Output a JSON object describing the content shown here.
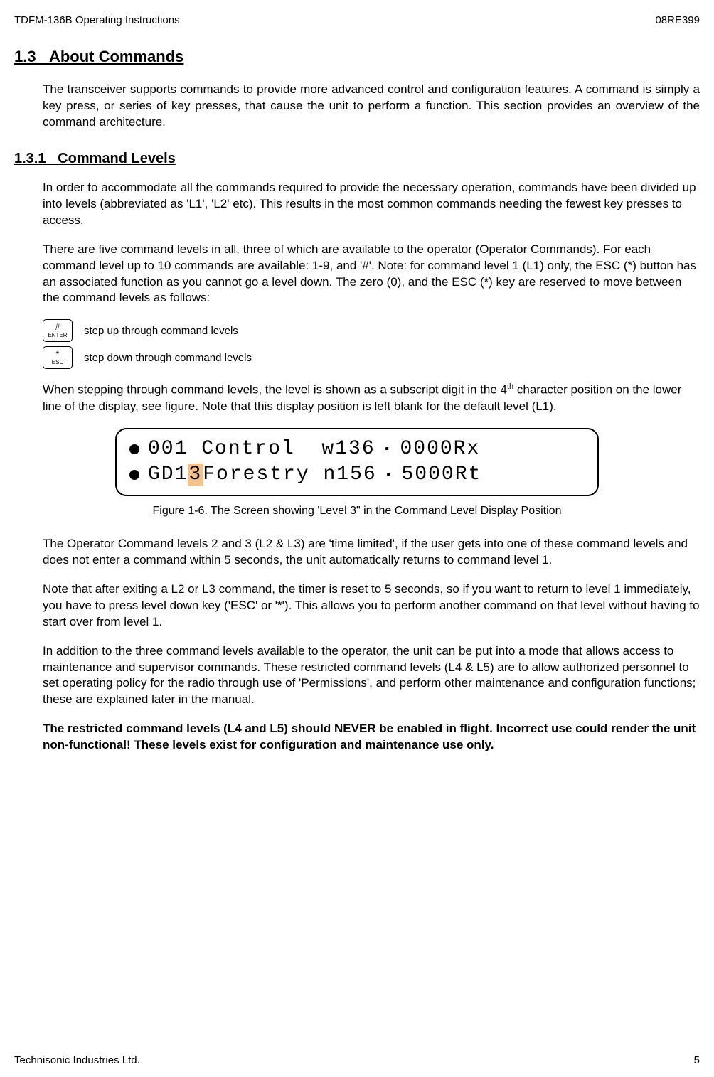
{
  "header": {
    "left": "TDFM-136B Operating Instructions",
    "right": "08RE399"
  },
  "sections": {
    "s13": {
      "number": "1.3",
      "title": "About Commands",
      "intro": "The transceiver supports commands to provide more advanced control and configuration features.  A command is simply a key press, or series of key presses, that cause the unit to perform a function.  This section provides an overview of the command architecture."
    },
    "s131": {
      "number": "1.3.1",
      "title": "Command Levels",
      "p1": "In order to accommodate all the commands required to provide the necessary operation, commands have been divided up into levels (abbreviated as 'L1', 'L2' etc). This results in the most common commands needing the fewest key presses to access.",
      "p2": "There are five command levels in all, three of which are available to the operator (Operator Commands).  For each command level up to 10 commands are available: 1-9, and  '#'.  Note: for command level 1 (L1) only, the ESC (*) button has an associated function as you cannot go a level down.  The zero (0), and the ESC (*) key are reserved to move between the command levels as follows:",
      "key1_top": "#",
      "key1_bot": "ENTER",
      "key1_label": "step up through command levels",
      "key2_top": "*",
      "key2_bot": "ESC",
      "key2_label": "step down through command levels",
      "p3a": "When stepping through command levels, the level is shown as a subscript digit in the 4",
      "p3sup": "th",
      "p3b": " character position on the lower line of the display, see figure. Note that this display position is left blank for the default level (L1).",
      "lcd": {
        "line1_a": "001 Control  w136",
        "line1_b": "0000Rx",
        "line2_a": "GD1",
        "line2_hl": "3",
        "line2_b": "Forestry n156",
        "line2_c": "5000Rt"
      },
      "figcaption": "Figure 1-6. The Screen showing 'Level 3\" in the Command Level Display Position",
      "p4": "The Operator Command levels 2 and 3 (L2 & L3) are 'time limited', if the user gets into one of these command levels and does not enter a command within 5 seconds, the unit automatically returns to command level 1.",
      "p5": "Note that after exiting a L2 or L3 command, the timer is reset to 5 seconds, so if you want to return to level 1 immediately, you have to press level down key ('ESC' or '*').  This allows you to perform another command on that level without having to start over from level 1.",
      "p6": "In addition to the three command levels available to the operator, the unit can be put into a mode that allows access to maintenance and supervisor commands. These restricted command levels (L4 & L5) are to allow authorized personnel to set operating policy for the radio through use of 'Permissions', and perform other maintenance and configuration functions; these are explained later in the manual.",
      "p7": "The restricted command levels (L4 and L5) should NEVER be enabled in flight.  Incorrect use could render the unit non-functional!  These levels exist for configuration and maintenance use only."
    }
  },
  "footer": {
    "left": "Technisonic Industries Ltd.",
    "page": "5"
  }
}
